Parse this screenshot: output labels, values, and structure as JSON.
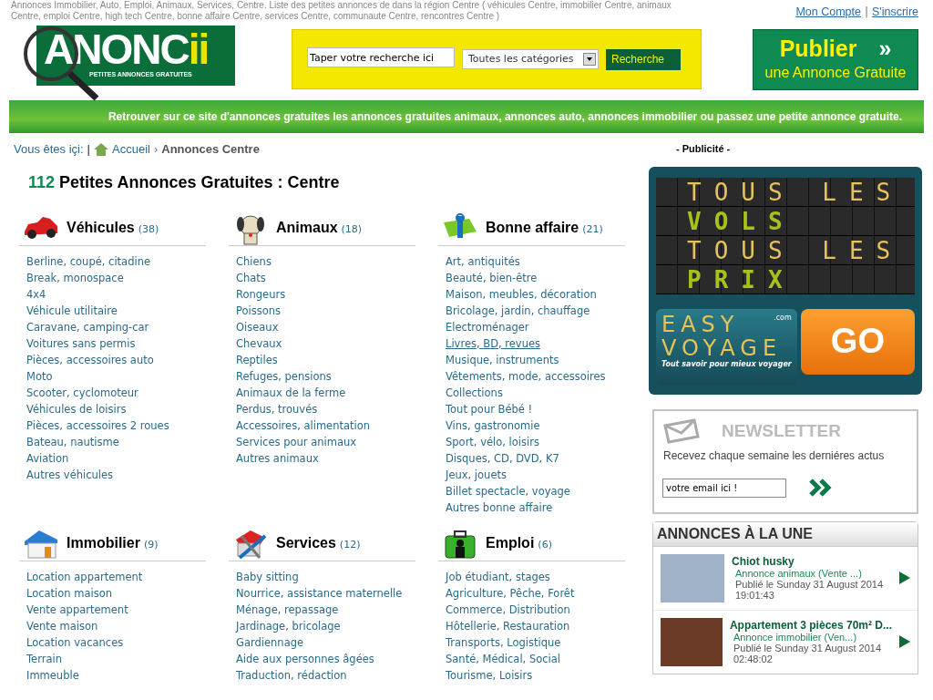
{
  "top_text": "Annonces Immobilier, Auto, Emploi, Animaux, Services, Centre. Liste des petites annonces de dans la région Centre ( véhicules Centre, immobilier Centre, animaux Centre, emploi Centre, high tech Centre, bonne affaire Centre, services Centre, communaute Centre, rencontres Centre )",
  "account_links": [
    "Mon Compte",
    "S'inscrire"
  ],
  "account_separator": "|",
  "logo": {
    "first_letter": "A",
    "main": "NONC",
    "accent": "ii",
    "tagline": "PETITES ANNONCES GRATUITES"
  },
  "search": {
    "value": "Taper votre recherche ici",
    "category": "Toutes les catégories",
    "button": "Recherche"
  },
  "publish": {
    "title": "Publier",
    "arrow": "»",
    "subtitle": "une Annonce Gratuite"
  },
  "banner": "Retrouver sur ce site d'annonces gratuites les annonces gratuites animaux, annonces auto, annonces immobilier ou passez une petite annonce gratuite.",
  "breadcrumb": {
    "label": "Vous êtes içi:",
    "separator": "|",
    "items": [
      {
        "label": "Accueil",
        "kind": "home"
      },
      {
        "label": "Annonces Centre",
        "kind": "current"
      }
    ],
    "arrow": "›"
  },
  "heading": {
    "count": "112",
    "text": "Petites Annonces Gratuites : Centre"
  },
  "categories": [
    {
      "kind": "car",
      "name": "Véhicules",
      "count": "(38)",
      "items": [
        {
          "label": "Berline, coupé, citadine",
          "hover": false
        },
        {
          "label": "Break, monospace",
          "hover": false
        },
        {
          "label": "4x4",
          "hover": false
        },
        {
          "label": "Véhicule utilitaire",
          "hover": false
        },
        {
          "label": "Caravane, camping-car",
          "hover": false
        },
        {
          "label": "Voitures sans permis",
          "hover": false
        },
        {
          "label": "Pièces, accessoires auto",
          "hover": false
        },
        {
          "label": "Moto",
          "hover": false
        },
        {
          "label": "Scooter, cyclomoteur",
          "hover": false
        },
        {
          "label": "Véhicules de loisirs",
          "hover": false
        },
        {
          "label": "Pièces, accessoires 2 roues",
          "hover": false
        },
        {
          "label": "Bateau, nautisme",
          "hover": false
        },
        {
          "label": "Aviation",
          "hover": false
        },
        {
          "label": "Autres véhicules",
          "hover": false
        }
      ]
    },
    {
      "kind": "dog",
      "name": "Animaux",
      "count": "(18)",
      "items": [
        {
          "label": "Chiens",
          "hover": false
        },
        {
          "label": "Chats",
          "hover": false
        },
        {
          "label": "Rongeurs",
          "hover": false
        },
        {
          "label": "Poissons",
          "hover": false
        },
        {
          "label": "Oiseaux",
          "hover": false
        },
        {
          "label": "Chevaux",
          "hover": false
        },
        {
          "label": "Reptiles",
          "hover": false
        },
        {
          "label": "Refuges, pensions",
          "hover": false
        },
        {
          "label": "Animaux de la ferme",
          "hover": false
        },
        {
          "label": "Perdus, trouvés",
          "hover": false
        },
        {
          "label": "Accessoires, alimentation",
          "hover": false
        },
        {
          "label": "Services pour animaux",
          "hover": false
        },
        {
          "label": "Autres animaux",
          "hover": false
        }
      ]
    },
    {
      "kind": "gift",
      "name": "Bonne affaire",
      "count": "(21)",
      "items": [
        {
          "label": "Art, antiquités",
          "hover": false
        },
        {
          "label": "Beauté, bien-être",
          "hover": false
        },
        {
          "label": "Maison, meubles, décoration",
          "hover": false
        },
        {
          "label": "Bricolage, jardin, chauffage",
          "hover": false
        },
        {
          "label": "Electroménager",
          "hover": false
        },
        {
          "label": "Livres, BD, revues",
          "hover": true
        },
        {
          "label": "Musique, instruments",
          "hover": false
        },
        {
          "label": "Vêtements, mode, accessoires",
          "hover": false
        },
        {
          "label": "Collections",
          "hover": false
        },
        {
          "label": "Tout pour Bébé !",
          "hover": false
        },
        {
          "label": "Vins, gastronomie",
          "hover": false
        },
        {
          "label": "Sport, vélo, loisirs",
          "hover": false
        },
        {
          "label": "Disques, CD, DVD, K7",
          "hover": false
        },
        {
          "label": "Jeux, jouets",
          "hover": false
        },
        {
          "label": "Billet spectacle, voyage",
          "hover": false
        },
        {
          "label": "Autres bonne affaire",
          "hover": false
        }
      ]
    },
    {
      "kind": "house",
      "name": "Immobilier",
      "count": "(9)",
      "items": [
        {
          "label": "Location appartement",
          "hover": false
        },
        {
          "label": "Location maison",
          "hover": false
        },
        {
          "label": "Vente appartement",
          "hover": false
        },
        {
          "label": "Vente maison",
          "hover": false
        },
        {
          "label": "Location vacances",
          "hover": false
        },
        {
          "label": "Terrain",
          "hover": false
        },
        {
          "label": "Immeuble",
          "hover": false
        }
      ]
    },
    {
      "kind": "tools",
      "name": "Services",
      "count": "(12)",
      "items": [
        {
          "label": "Baby sitting",
          "hover": false
        },
        {
          "label": "Nourrice, assistance maternelle",
          "hover": false
        },
        {
          "label": "Ménage, repassage",
          "hover": false
        },
        {
          "label": "Jardinage, bricolage",
          "hover": false
        },
        {
          "label": "Gardiennage",
          "hover": false
        },
        {
          "label": "Aide aux personnes âgées",
          "hover": false
        },
        {
          "label": "Traduction, rédaction",
          "hover": false
        }
      ]
    },
    {
      "kind": "briefcase",
      "name": "Emploi",
      "count": "(6)",
      "items": [
        {
          "label": "Job étudiant, stages",
          "hover": false
        },
        {
          "label": "Agriculture, Pêche, Forêt",
          "hover": false
        },
        {
          "label": "Commerce, Distribution",
          "hover": false
        },
        {
          "label": "Hôtellerie, Restauration",
          "hover": false
        },
        {
          "label": "Transports, Logistique",
          "hover": false
        },
        {
          "label": "Santé, Médical, Social",
          "hover": false
        },
        {
          "label": "Tourisme, Loisirs",
          "hover": false
        }
      ]
    }
  ],
  "ad": {
    "label": "- Publicité -",
    "board": [
      {
        "text": "TOUS LES",
        "kind": "plain"
      },
      {
        "text": "VOLS",
        "kind": "bold"
      },
      {
        "text": "TOUS LES",
        "kind": "plain"
      },
      {
        "text": "PRIX",
        "kind": "bold"
      }
    ],
    "brand_lines": [
      "EASY",
      "VOYAGE"
    ],
    "brand_domain": ".com",
    "tagline": "Tout savoir pour mieux voyager",
    "go": "GO"
  },
  "newsletter": {
    "title": "NEWSLETTER",
    "text": "Recevez chaque semaine les derniéres actus",
    "email": "votre email ici !"
  },
  "featured": {
    "title": "ANNONCES À LA UNE",
    "items": [
      {
        "title": "Chiot husky",
        "category": "Annonce animaux (Vente ...)",
        "published": "Publié le Sunday 31 August 2014",
        "time": "19:01:43"
      },
      {
        "title": "Appartement 3 pièces 70m² D...",
        "category": "Annonce immobilier (Ven...)",
        "published": "Publié le Sunday 31 August 2014",
        "time": "02:48:02"
      }
    ]
  }
}
